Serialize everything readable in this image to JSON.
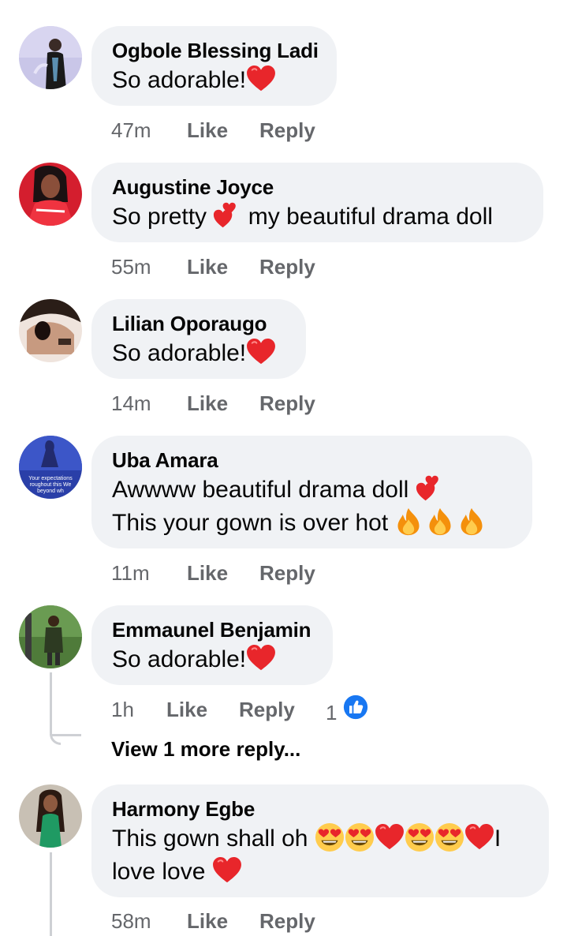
{
  "comments": [
    {
      "name": "Ogbole Blessing Ladi",
      "text": "So adorable!",
      "emoji": [
        "red-heart-icon"
      ],
      "time": "47m",
      "like": "Like",
      "reply": "Reply"
    },
    {
      "name": "Augustine Joyce",
      "text_before": "So pretty",
      "text_after": "my beautiful drama doll",
      "emoji": [
        "two-hearts-icon"
      ],
      "time": "55m",
      "like": "Like",
      "reply": "Reply"
    },
    {
      "name": "Lilian Oporaugo",
      "text": "So adorable!",
      "emoji": [
        "red-heart-icon"
      ],
      "time": "14m",
      "like": "Like",
      "reply": "Reply"
    },
    {
      "name": "Uba Amara",
      "line1": "Awwww beautiful drama doll",
      "line2": "This your gown is over hot",
      "avatar_caption": [
        "Your expectations",
        "roughout this We",
        "beyond wh"
      ],
      "emoji": [
        "two-hearts-icon",
        "fire-icon",
        "fire-icon",
        "fire-icon"
      ],
      "time": "11m",
      "like": "Like",
      "reply": "Reply"
    },
    {
      "name": "Emmaunel Benjamin",
      "text": "So adorable!",
      "emoji": [
        "red-heart-icon"
      ],
      "time": "1h",
      "like": "Like",
      "reply": "Reply",
      "reaction_count": "1",
      "reaction_icon": "like-thumb-icon"
    },
    {
      "name": "Harmony Egbe",
      "line1_text": "This gown shall oh",
      "line1_tail": "I",
      "line2": "love love",
      "emoji": [
        "heart-eyes-icon",
        "heart-eyes-icon",
        "red-heart-icon",
        "heart-eyes-icon",
        "heart-eyes-icon",
        "red-heart-icon",
        "red-heart-icon"
      ],
      "time": "58m",
      "like": "Like",
      "reply": "Reply"
    }
  ],
  "view_more": "View 1 more reply...",
  "colors": {
    "bubble": "#f0f2f5",
    "meta": "#65676b",
    "text": "#050505",
    "like_blue": "#1877f2",
    "heart_red": "#e8262b",
    "thread_line": "#ced0d4"
  }
}
